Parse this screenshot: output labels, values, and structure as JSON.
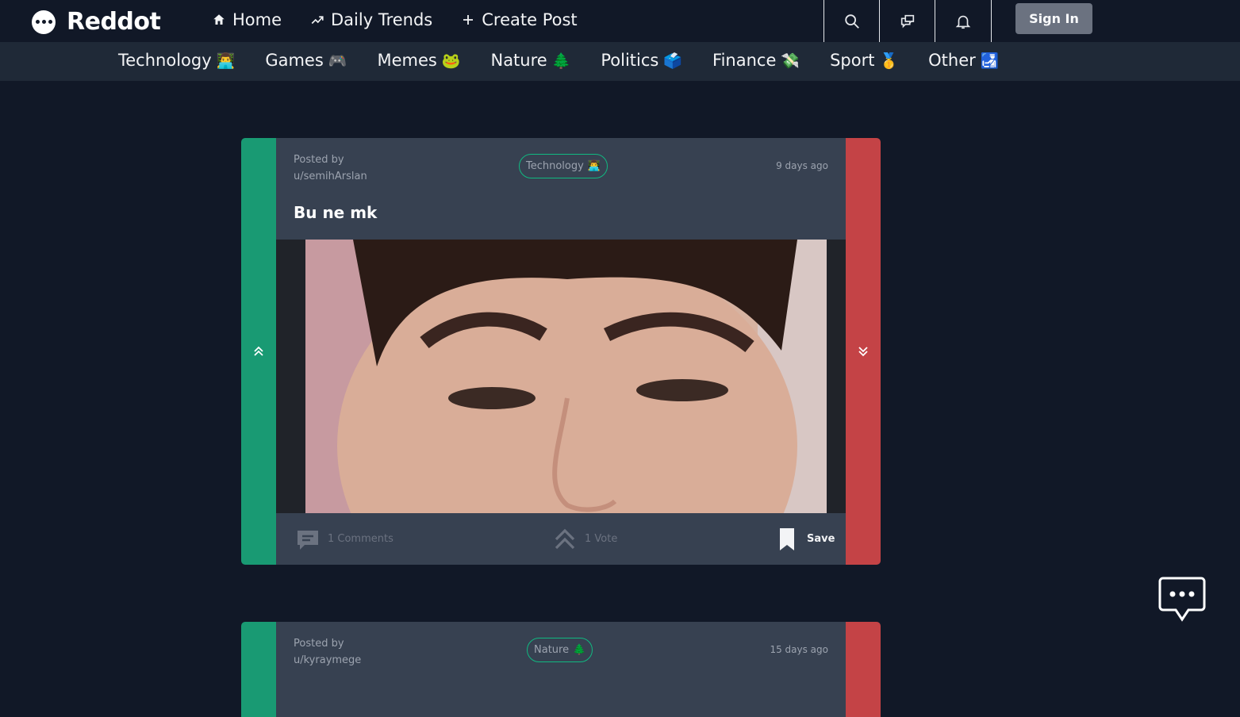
{
  "brand": {
    "name": "Reddot"
  },
  "nav": {
    "links": [
      {
        "label": "Home",
        "icon": "home-icon"
      },
      {
        "label": "Daily Trends",
        "icon": "trending-up-icon"
      },
      {
        "label": "Create Post",
        "icon": "plus-icon"
      }
    ],
    "icons": [
      "search-icon",
      "chat-bubbles-icon",
      "bell-icon"
    ],
    "signin_label": "Sign In"
  },
  "categories": [
    {
      "label": "Technology",
      "emoji": "👨‍💻"
    },
    {
      "label": "Games",
      "emoji": "🎮"
    },
    {
      "label": "Memes",
      "emoji": "🐸"
    },
    {
      "label": "Nature",
      "emoji": "🌲"
    },
    {
      "label": "Politics",
      "emoji": "🗳️"
    },
    {
      "label": "Finance",
      "emoji": "💸"
    },
    {
      "label": "Sport",
      "emoji": "🥇"
    },
    {
      "label": "Other",
      "emoji": "🛃"
    }
  ],
  "posts": [
    {
      "posted_by_label": "Posted by",
      "author": "u/semihArslan",
      "tag": "Technology",
      "tag_emoji": "👨‍💻",
      "time": "9 days ago",
      "title": "Bu ne mk",
      "comments": "1 Comments",
      "votes": "1 Vote",
      "save_label": "Save"
    },
    {
      "posted_by_label": "Posted by",
      "author": "u/kyraymege",
      "tag": "Nature",
      "tag_emoji": "🌲",
      "time": "15 days ago"
    }
  ],
  "colors": {
    "background": "#111827",
    "category_bar": "#1f2937",
    "card": "#374151",
    "upvote": "#199a73",
    "downvote": "#c44346",
    "tag_border": "#10b981"
  }
}
